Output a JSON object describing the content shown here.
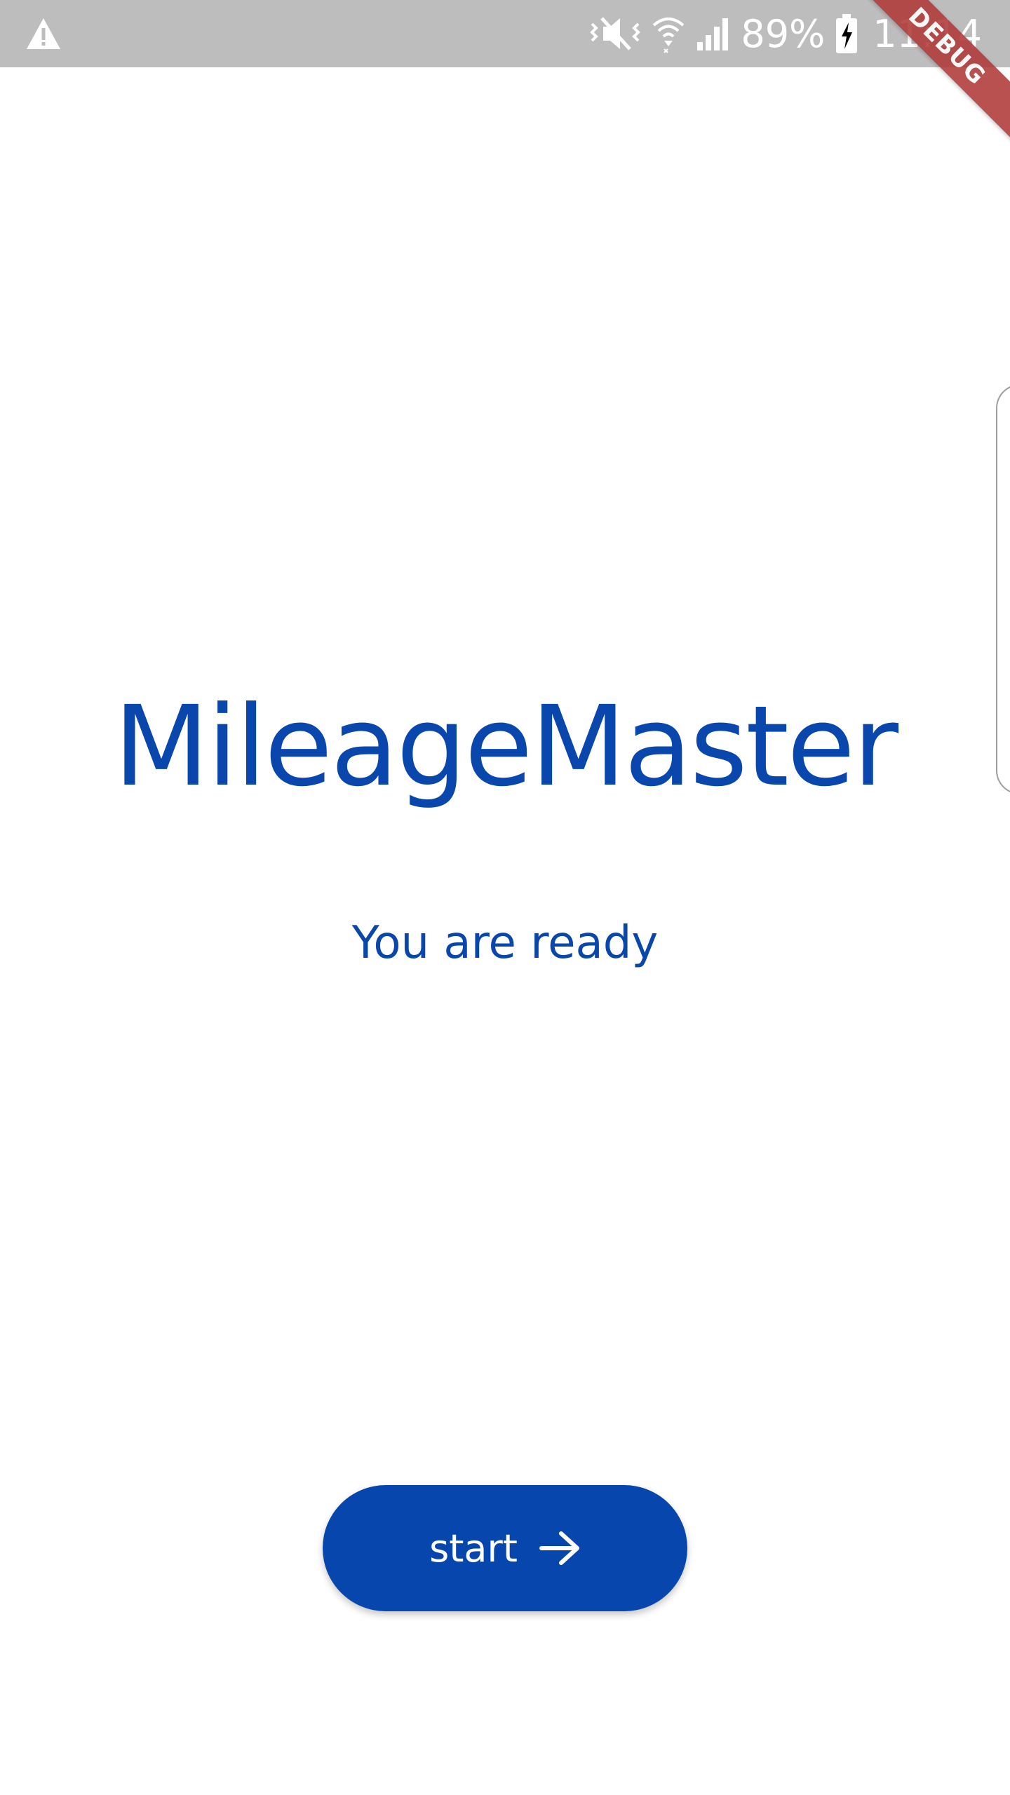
{
  "status_bar": {
    "battery_percent": "89%",
    "time": "11:14",
    "icons": [
      "warning-icon",
      "vibrate-mute-icon",
      "wifi-icon",
      "signal-icon",
      "battery-charging-icon"
    ]
  },
  "debug_banner": {
    "label": "DEBUG"
  },
  "app": {
    "title": "MileageMaster",
    "subtitle": "You are ready",
    "start_button_label": "start",
    "start_button_icon": "arrow-right-icon"
  },
  "colors": {
    "brand_blue": "#0747ad",
    "status_bar": "#bdbdbd",
    "debug_ribbon": "#b13a3a",
    "background": "#ffffff"
  }
}
